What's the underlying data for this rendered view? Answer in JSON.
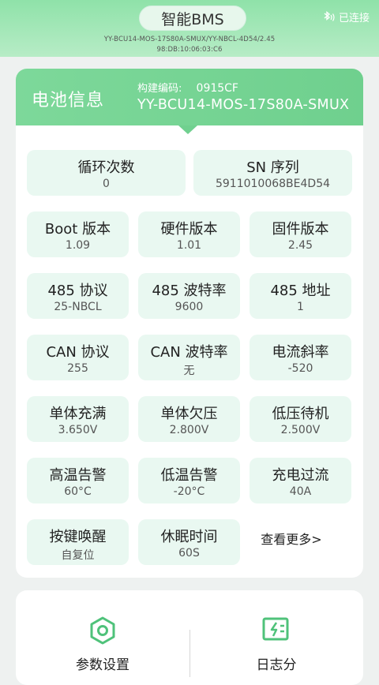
{
  "header": {
    "app_title": "智能BMS",
    "connection_status": "已连接",
    "device_line1": "YY-BCU14-MOS-17S80A-SMUX/YY-NBCL-4D54/2.45",
    "device_line2": "98:DB:10:06:03:C6",
    "icons": {
      "bluetooth": "bluetooth-icon"
    }
  },
  "battery_card": {
    "title": "电池信息",
    "build_label": "构建编码:",
    "build_code": "0915CF",
    "model": "YY-BCU14-MOS-17S80A-SMUX"
  },
  "info": {
    "cycle_count": {
      "label": "循环次数",
      "value": "0"
    },
    "sn": {
      "label": "SN 序列",
      "value": "5911010068BE4D54"
    },
    "boot": {
      "label": "Boot 版本",
      "value": "1.09"
    },
    "hardware": {
      "label": "硬件版本",
      "value": "1.01"
    },
    "firmware": {
      "label": "固件版本",
      "value": "2.45"
    },
    "p485_protocol": {
      "label": "485 协议",
      "value": "25-NBCL"
    },
    "p485_baud": {
      "label": "485 波特率",
      "value": "9600"
    },
    "p485_addr": {
      "label": "485 地址",
      "value": "1"
    },
    "can_protocol": {
      "label": "CAN 协议",
      "value": "255"
    },
    "can_baud": {
      "label": "CAN 波特率",
      "value": "无"
    },
    "current_slope": {
      "label": "电流斜率",
      "value": "-520"
    },
    "cell_full": {
      "label": "单体充满",
      "value": "3.650V"
    },
    "cell_under": {
      "label": "单体欠压",
      "value": "2.800V"
    },
    "low_standby": {
      "label": "低压待机",
      "value": "2.500V"
    },
    "high_temp": {
      "label": "高温告警",
      "value": "60°C"
    },
    "low_temp": {
      "label": "低温告警",
      "value": "-20°C"
    },
    "charge_over": {
      "label": "充电过流",
      "value": "40A"
    },
    "key_wake": {
      "label": "按键唤醒",
      "value": "自复位"
    },
    "sleep_time": {
      "label": "休眠时间",
      "value": "60S"
    },
    "more_link": "查看更多>"
  },
  "bottom_nav": {
    "params": {
      "label": "参数设置",
      "icon": "gear-nut-icon"
    },
    "log": {
      "label": "日志分",
      "icon": "log-icon"
    }
  },
  "colors": {
    "accent_green": "#70d08f",
    "tile_bg": "#e9f8f1"
  }
}
